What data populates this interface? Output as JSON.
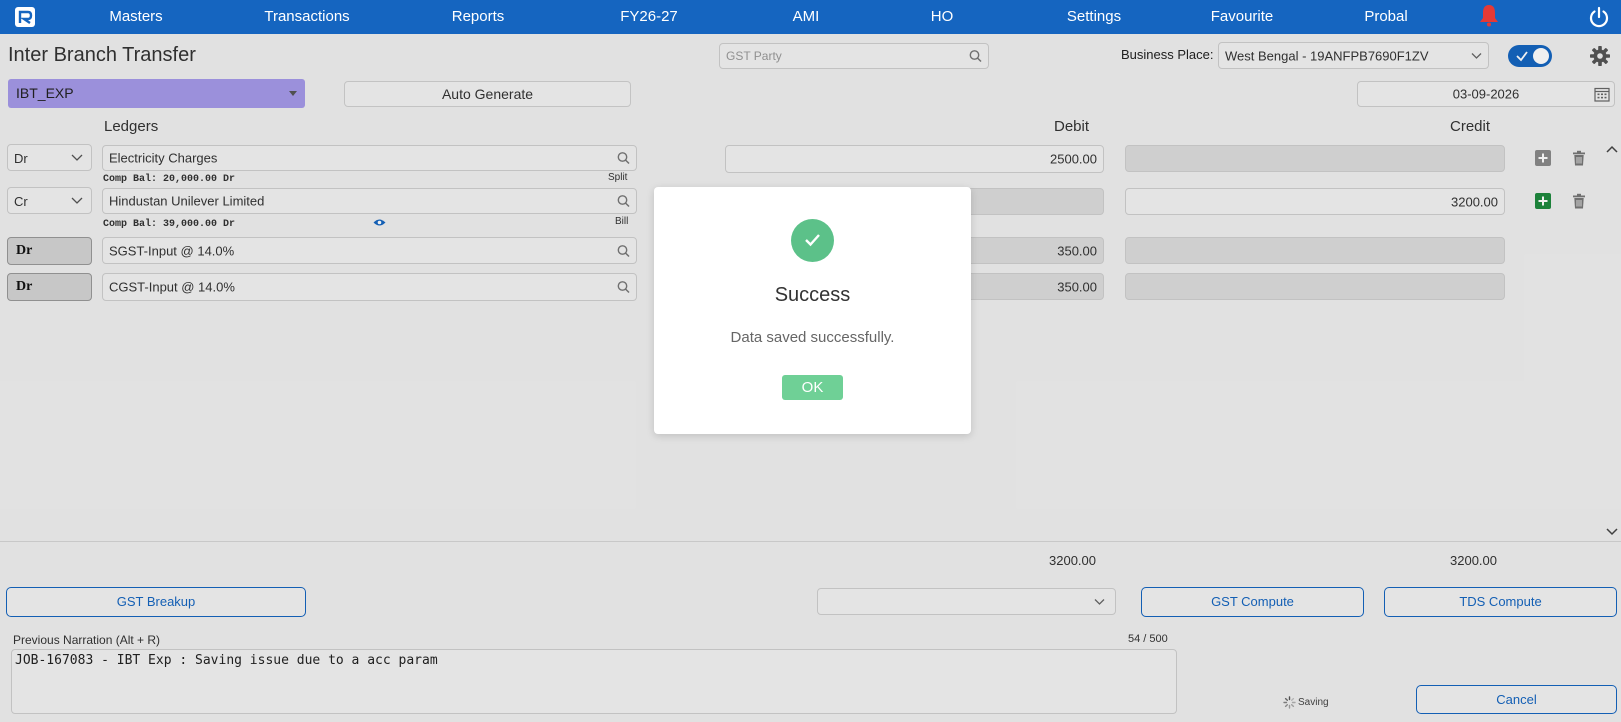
{
  "nav": {
    "items": [
      "Masters",
      "Transactions",
      "Reports",
      "FY26-27",
      "AMI",
      "HO",
      "Settings",
      "Favourite",
      "Probal"
    ]
  },
  "page": {
    "title": "Inter Branch Transfer"
  },
  "header": {
    "gst_party_placeholder": "GST Party",
    "business_place_label": "Business Place:",
    "business_place_value": "West Bengal - 19ANFPB7690F1ZV"
  },
  "voucher": {
    "type": "IBT_EXP",
    "auto_generate_label": "Auto Generate",
    "date": "03-09-2026"
  },
  "columns": {
    "ledgers": "Ledgers",
    "debit": "Debit",
    "credit": "Credit"
  },
  "rows": [
    {
      "drcr": "Dr",
      "ledger": "Electricity Charges",
      "comp_bal": "Comp Bal: 20,000.00 Dr",
      "link": "Split",
      "debit": "2500.00",
      "credit": ""
    },
    {
      "drcr": "Cr",
      "ledger": "Hindustan Unilever Limited",
      "comp_bal": "Comp Bal: 39,000.00 Dr",
      "link": "Bill",
      "debit": "",
      "credit": "3200.00"
    },
    {
      "drcr": "Dr",
      "ledger": "SGST-Input @ 14.0%",
      "debit": "350.00",
      "credit": ""
    },
    {
      "drcr": "Dr",
      "ledger": "CGST-Input @ 14.0%",
      "debit": "350.00",
      "credit": ""
    }
  ],
  "totals": {
    "debit": "3200.00",
    "credit": "3200.00"
  },
  "footer": {
    "gst_breakup": "GST Breakup",
    "gst_compute": "GST Compute",
    "tds_compute": "TDS Compute",
    "cancel": "Cancel",
    "saving": "Saving"
  },
  "narration": {
    "label": "Previous Narration (Alt + R)",
    "count": "54 / 500",
    "text": "JOB-167083 - IBT Exp : Saving issue due to a acc param"
  },
  "modal": {
    "title": "Success",
    "message": "Data saved successfully.",
    "ok_label": "OK"
  },
  "colors": {
    "nav_bg": "#1565c0",
    "voucher_type_bg": "#a59ae9",
    "success_green": "#5cc189",
    "ok_button": "#6fd096",
    "add_row_green": "#1e8a3e",
    "bell_red": "#e53935"
  }
}
